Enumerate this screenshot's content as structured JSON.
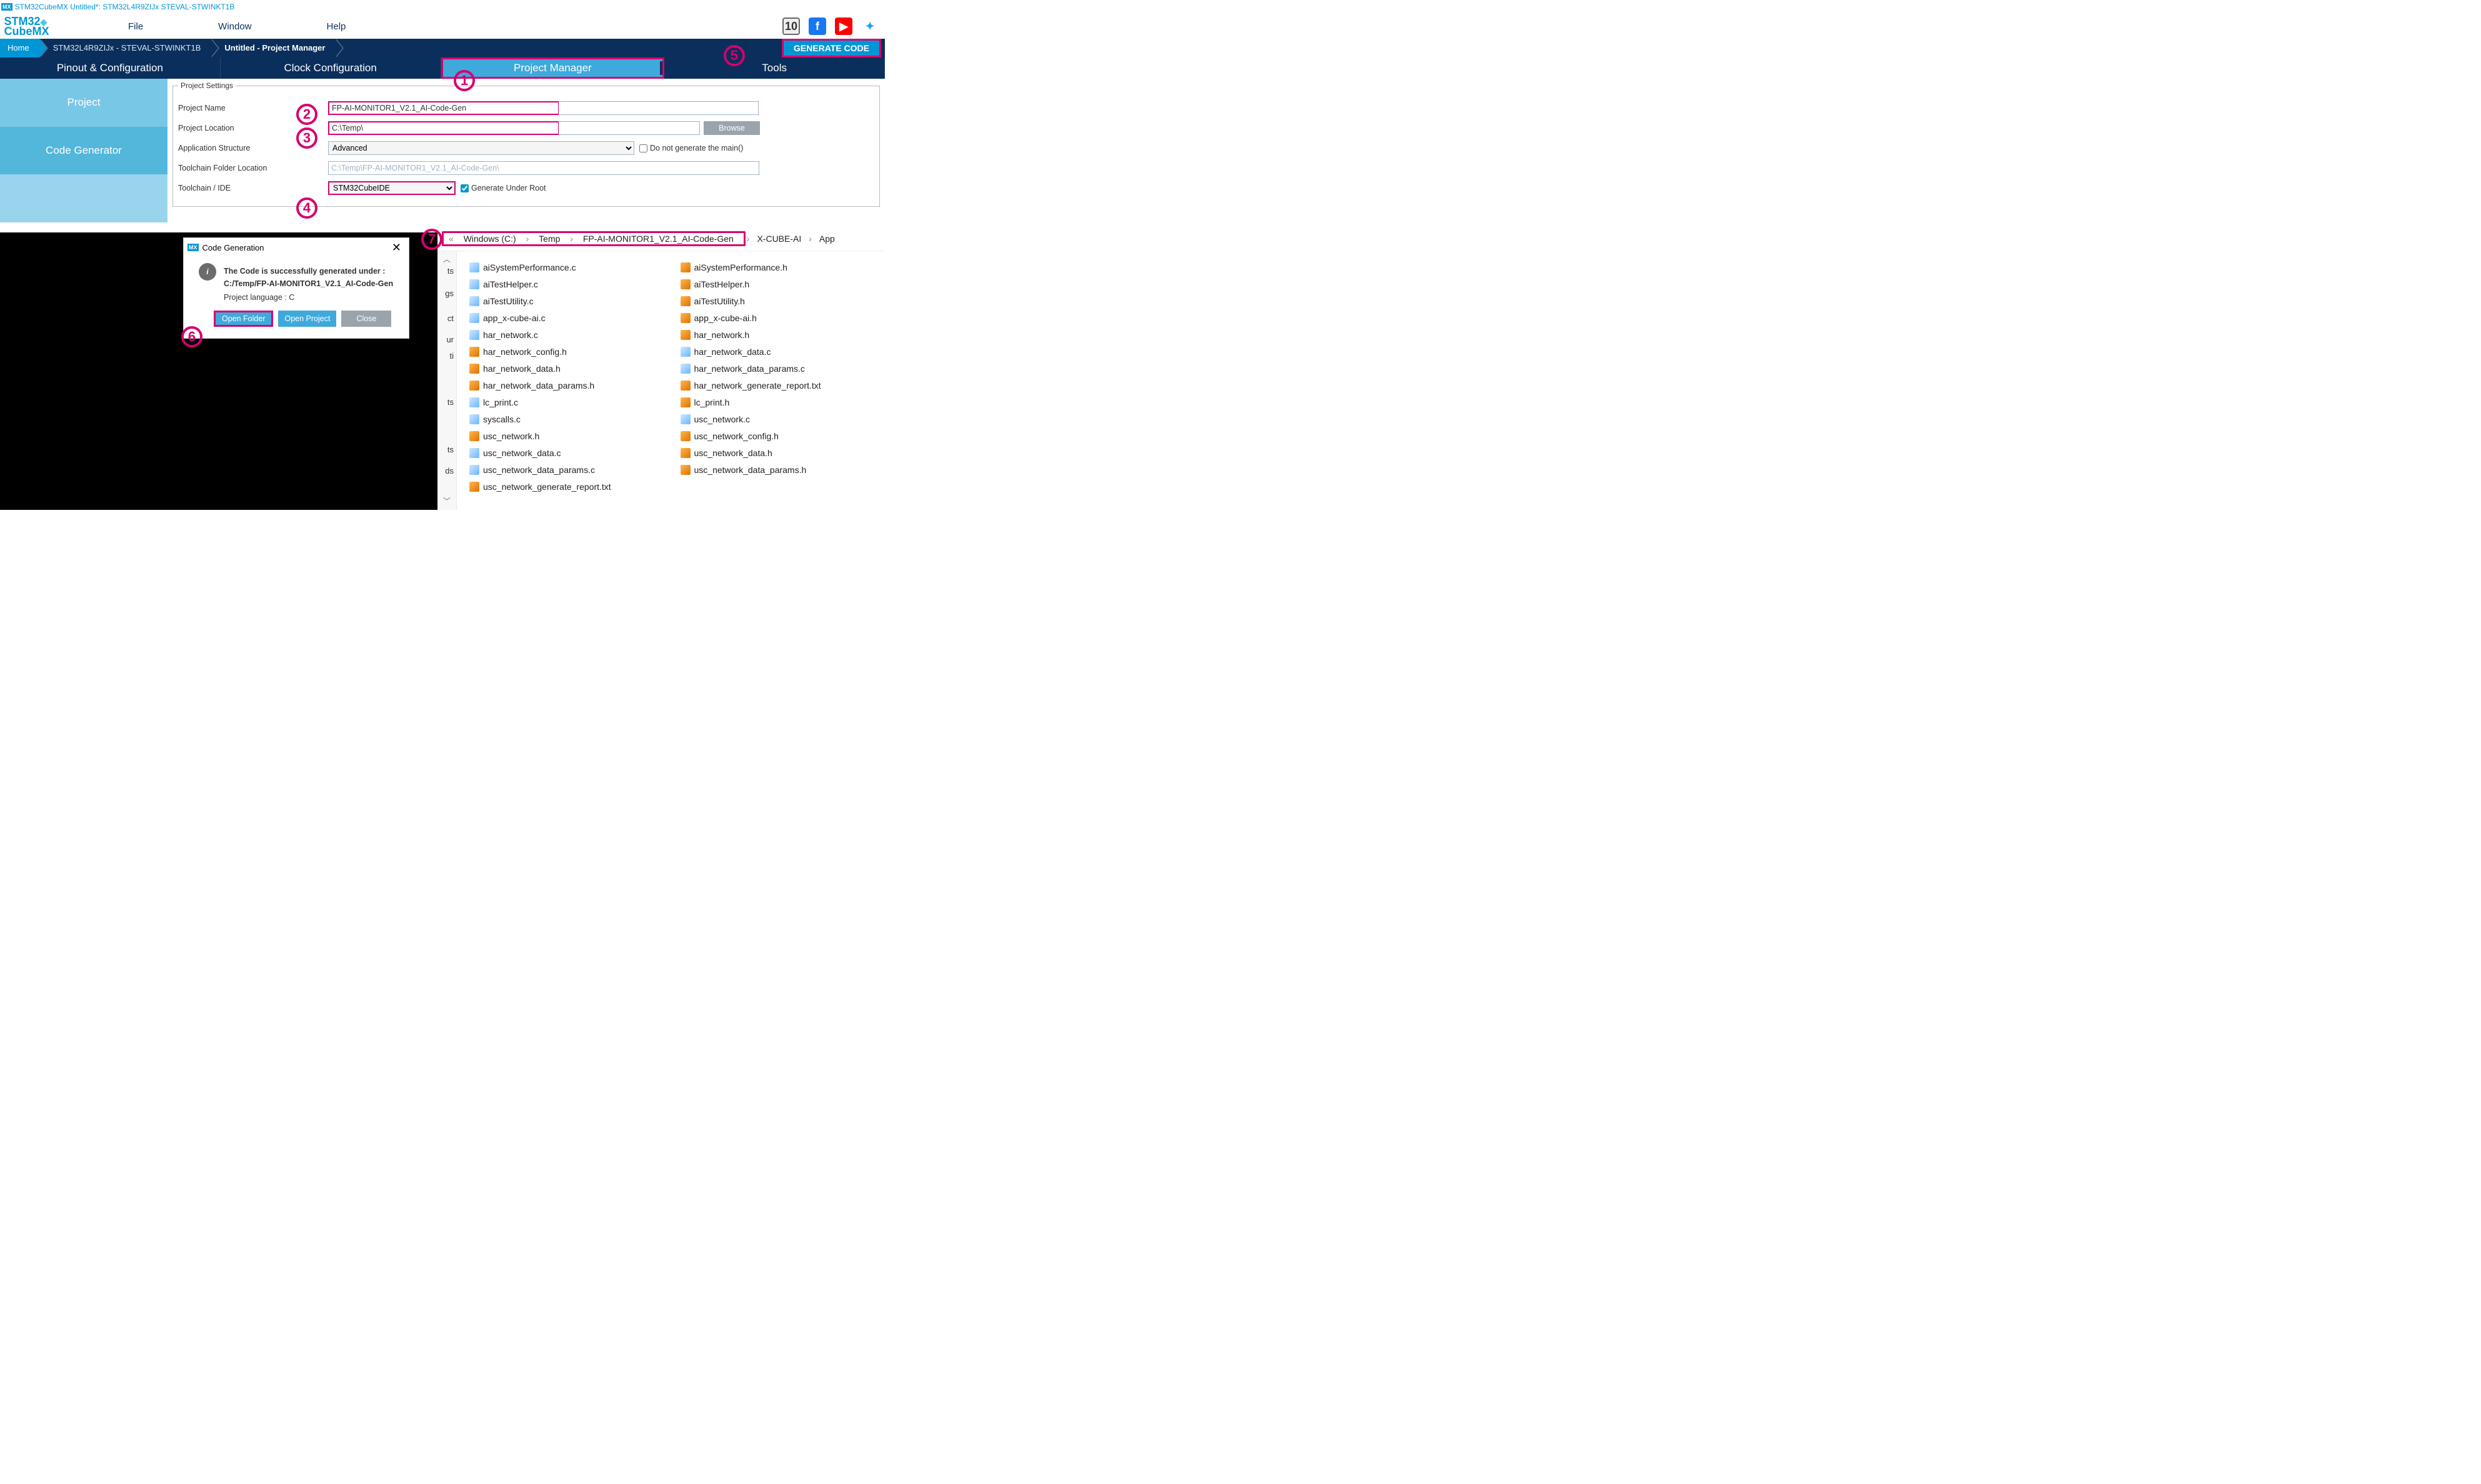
{
  "window_title": "STM32CubeMX Untitled*: STM32L4R9ZIJx STEVAL-STWINKT1B",
  "logo": {
    "top": "STM32",
    "bottom": "CubeMX"
  },
  "menu": {
    "file": "File",
    "window": "Window",
    "help": "Help"
  },
  "crumbs": {
    "home": "Home",
    "device": "STM32L4R9ZIJx  -  STEVAL-STWINKT1B",
    "page": "Untitled - Project Manager"
  },
  "generate_btn": "GENERATE CODE",
  "tabs": {
    "pinout": "Pinout & Configuration",
    "clock": "Clock Configuration",
    "pm": "Project Manager",
    "tools": "Tools"
  },
  "sidebar": {
    "project": "Project",
    "codegen": "Code Generator"
  },
  "form": {
    "legend": "Project Settings",
    "name_label": "Project Name",
    "name_value": "FP-AI-MONITOR1_V2.1_AI-Code-Gen",
    "loc_label": "Project Location",
    "loc_value": "C:\\Temp\\",
    "browse": "Browse",
    "appstruct_label": "Application Structure",
    "appstruct_value": "Advanced",
    "nomain_label": "Do not generate the main()",
    "tcfolder_label": "Toolchain Folder Location",
    "tcfolder_value": "C:\\Temp\\FP-AI-MONITOR1_V2.1_AI-Code-Gen\\",
    "tcide_label": "Toolchain / IDE",
    "tcide_value": "STM32CubeIDE",
    "gen_under_root": "Generate Under Root"
  },
  "dialog": {
    "title": "Code Generation",
    "msg": "The Code is successfully generated under :",
    "path": "C:/Temp/FP-AI-MONITOR1_V2.1_AI-Code-Gen",
    "lang": "Project language : C",
    "open_folder": "Open Folder",
    "open_project": "Open Project",
    "close": "Close"
  },
  "explorer": {
    "segs": [
      "Windows (C:)",
      "Temp",
      "FP-AI-MONITOR1_V2.1_AI-Code-Gen",
      "X-CUBE-AI",
      "App"
    ],
    "frags": [
      "ts",
      "gs",
      "ct",
      "ur",
      "ti",
      "ts",
      "ts",
      "ds"
    ],
    "files_left": [
      {
        "n": "aiSystemPerformance.c",
        "t": "c"
      },
      {
        "n": "aiTestHelper.c",
        "t": "c"
      },
      {
        "n": "aiTestUtility.c",
        "t": "c"
      },
      {
        "n": "app_x-cube-ai.c",
        "t": "c"
      },
      {
        "n": "har_network.c",
        "t": "c"
      },
      {
        "n": "har_network_config.h",
        "t": "h"
      },
      {
        "n": "har_network_data.h",
        "t": "h"
      },
      {
        "n": "har_network_data_params.h",
        "t": "h"
      },
      {
        "n": "lc_print.c",
        "t": "c"
      },
      {
        "n": "syscalls.c",
        "t": "c"
      },
      {
        "n": "usc_network.h",
        "t": "h"
      },
      {
        "n": "usc_network_data.c",
        "t": "c"
      },
      {
        "n": "usc_network_data_params.c",
        "t": "c"
      },
      {
        "n": "usc_network_generate_report.txt",
        "t": "h"
      }
    ],
    "files_right": [
      {
        "n": "aiSystemPerformance.h",
        "t": "h"
      },
      {
        "n": "aiTestHelper.h",
        "t": "h"
      },
      {
        "n": "aiTestUtility.h",
        "t": "h"
      },
      {
        "n": "app_x-cube-ai.h",
        "t": "h"
      },
      {
        "n": "har_network.h",
        "t": "h"
      },
      {
        "n": "har_network_data.c",
        "t": "c"
      },
      {
        "n": "har_network_data_params.c",
        "t": "c"
      },
      {
        "n": "har_network_generate_report.txt",
        "t": "h"
      },
      {
        "n": "lc_print.h",
        "t": "h"
      },
      {
        "n": "usc_network.c",
        "t": "c"
      },
      {
        "n": "usc_network_config.h",
        "t": "h"
      },
      {
        "n": "usc_network_data.h",
        "t": "h"
      },
      {
        "n": "usc_network_data_params.h",
        "t": "h"
      }
    ]
  },
  "callouts": {
    "1": "1",
    "2": "2",
    "3": "3",
    "4": "4",
    "5": "5",
    "6": "6",
    "7": "7"
  }
}
